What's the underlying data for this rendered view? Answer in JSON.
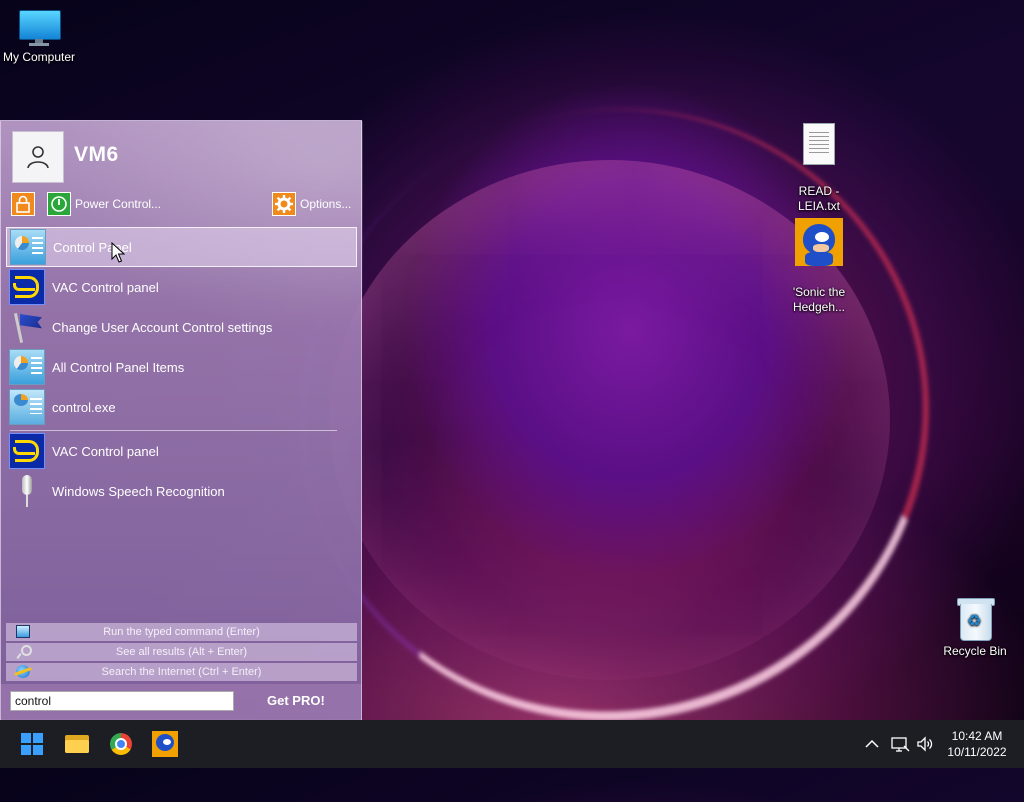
{
  "desktop": {
    "icons": [
      {
        "label": "My Computer",
        "icon": "computer-icon"
      },
      {
        "label": "READ -\nLEIA.txt",
        "icon": "text-file-icon"
      },
      {
        "label": "'Sonic the\nHedgeh...",
        "icon": "sonic-icon"
      },
      {
        "label": "Recycle Bin",
        "icon": "recycle-bin-icon"
      }
    ]
  },
  "start_menu": {
    "username": "VM6",
    "power_control_label": "Power Control...",
    "options_label": "Options...",
    "results": [
      {
        "label": "Control Panel",
        "icon": "control-panel-icon",
        "selected": true
      },
      {
        "label": "VAC Control panel",
        "icon": "vac-icon"
      },
      {
        "label": "Change User Account Control settings",
        "icon": "uac-flag-icon"
      },
      {
        "label": "All Control Panel Items",
        "icon": "control-panel-icon"
      },
      {
        "label": "control.exe",
        "icon": "control-exe-icon"
      }
    ],
    "other_results": [
      {
        "label": "VAC Control panel",
        "icon": "vac-icon"
      },
      {
        "label": "Windows Speech Recognition",
        "icon": "microphone-icon"
      }
    ],
    "commands": {
      "run": "Run the typed command (Enter)",
      "see_all": "See all results (Alt + Enter)",
      "search_web": "Search the Internet (Ctrl + Enter)"
    },
    "search_value": "control",
    "get_pro_label": "Get PRO!"
  },
  "taskbar": {
    "apps": [
      "start-icon",
      "file-explorer-icon",
      "chrome-icon",
      "sonic-icon"
    ],
    "clock": {
      "time": "10:42 AM",
      "date": "10/11/2022"
    }
  },
  "colors": {
    "menu_bg": "#a582b8",
    "taskbar_bg": "#1d1d24",
    "accent_orange": "#f08a1c",
    "accent_green": "#2aa63a",
    "start_blue": "#3aa0ff"
  }
}
